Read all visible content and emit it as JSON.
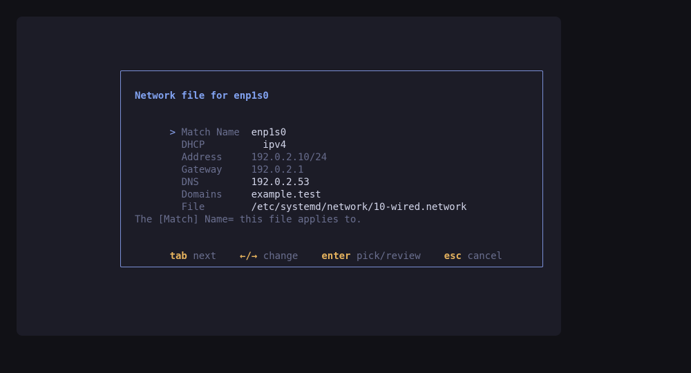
{
  "dialog": {
    "title": "Network file for enp1s0",
    "rows": [
      {
        "cursor": ">",
        "label": "Match Name",
        "value": "enp1s0",
        "state": "on"
      },
      {
        "cursor": "",
        "label": "DHCP",
        "value": "  ipv4",
        "state": "on"
      },
      {
        "cursor": "",
        "label": "Address",
        "value": "192.0.2.10/24",
        "state": "off"
      },
      {
        "cursor": "",
        "label": "Gateway",
        "value": "192.0.2.1",
        "state": "off"
      },
      {
        "cursor": "",
        "label": "DNS",
        "value": "192.0.2.53",
        "state": "on"
      },
      {
        "cursor": "",
        "label": "Domains",
        "value": "example.test",
        "state": "on"
      },
      {
        "cursor": "",
        "label": "File",
        "value": "/etc/systemd/network/10-wired.network",
        "state": "on"
      }
    ],
    "help_text": "The [Match] Name= this file applies to.",
    "keys": [
      {
        "key": "tab",
        "desc": "next"
      },
      {
        "key": "←/→",
        "desc": "change"
      },
      {
        "key": "enter",
        "desc": "pick/review"
      },
      {
        "key": "esc",
        "desc": "cancel"
      }
    ]
  },
  "colors": {
    "accent": "#82a3f2",
    "key": "#e6b35e",
    "border": "#7b8fd6",
    "background": "#1c1c27"
  }
}
